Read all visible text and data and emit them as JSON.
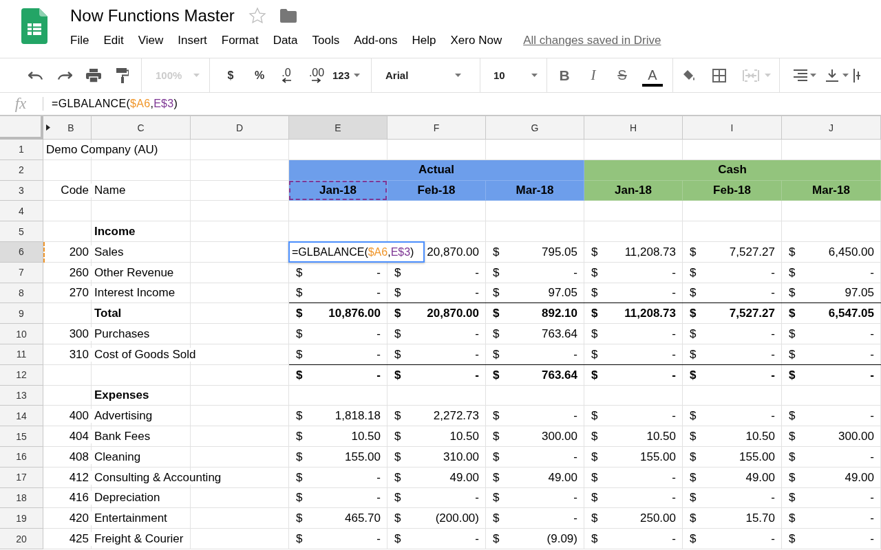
{
  "app": {
    "title": "Now Functions Master",
    "starred": false,
    "save_status": "All changes saved in Drive"
  },
  "menu": [
    "File",
    "Edit",
    "View",
    "Insert",
    "Format",
    "Data",
    "Tools",
    "Add-ons",
    "Help",
    "Xero Now"
  ],
  "toolbar": {
    "zoom": {
      "label": "100%",
      "disabled": true
    },
    "currency": "$",
    "percent": "%",
    "decrease_decimals": ".0",
    "increase_decimals": ".00",
    "number_format": "123",
    "font": "Arial",
    "font_size": "10",
    "bold": "B",
    "italic": "I",
    "strikethrough": "S",
    "text_color": "A"
  },
  "formula_bar": {
    "label": "fx",
    "formula": [
      {
        "text": "=GLBALANCE("
      },
      {
        "text": "$A6",
        "color": "#f0962a"
      },
      {
        "text": ","
      },
      {
        "text": "E$3",
        "color": "#7e3794"
      },
      {
        "text": ")"
      }
    ]
  },
  "columns": [
    {
      "label": "B",
      "selected": false
    },
    {
      "label": "C",
      "selected": false
    },
    {
      "label": "D",
      "selected": false
    },
    {
      "label": "E",
      "selected": true
    },
    {
      "label": "F",
      "selected": false
    },
    {
      "label": "G",
      "selected": false
    },
    {
      "label": "H",
      "selected": false
    },
    {
      "label": "I",
      "selected": false
    },
    {
      "label": "J",
      "selected": false
    }
  ],
  "rows": [
    {
      "number": "1",
      "selected": false,
      "label": "Demo Company (AU)"
    },
    {
      "number": "2",
      "selected": false,
      "bands": [
        {
          "label": "Actual",
          "color": "#6d9eeb"
        },
        {
          "label": "Cash",
          "color": "#93c47d"
        }
      ]
    },
    {
      "number": "3",
      "selected": false,
      "code": "Code",
      "name": "Name",
      "months": [
        {
          "label": "Jan-18",
          "color": "#6d9eeb",
          "referenced": true
        },
        {
          "label": "Feb-18",
          "color": "#6d9eeb",
          "referenced": false
        },
        {
          "label": "Mar-18",
          "color": "#6d9eeb",
          "referenced": false
        },
        {
          "label": "Jan-18",
          "color": "#93c47d",
          "referenced": false
        },
        {
          "label": "Feb-18",
          "color": "#93c47d",
          "referenced": false
        },
        {
          "label": "Mar-18",
          "color": "#93c47d",
          "referenced": false
        }
      ]
    },
    {
      "number": "4",
      "selected": false
    },
    {
      "number": "5",
      "selected": false,
      "name": "Income",
      "bold": true
    },
    {
      "number": "6",
      "selected": true,
      "referenced": true,
      "code": "200",
      "name": "Sales",
      "editor": [
        {
          "text": "=GLBALANCE("
        },
        {
          "text": "$A6",
          "color": "#f0962a"
        },
        {
          "text": ","
        },
        {
          "text": "E$3",
          "color": "#7e3794"
        },
        {
          "text": ")"
        }
      ],
      "values": [
        {
          "amount": "20,870.00"
        },
        {
          "sign": "$",
          "amount": "795.05"
        },
        {
          "sign": "$",
          "amount": "11,208.73"
        },
        {
          "sign": "$",
          "amount": "7,527.27"
        },
        {
          "sign": "$",
          "amount": "6,450.00"
        }
      ]
    },
    {
      "number": "7",
      "selected": false,
      "code": "260",
      "name": "Other Revenue",
      "values": [
        {
          "sign": "$",
          "amount": "-"
        },
        {
          "sign": "$",
          "amount": "-"
        },
        {
          "sign": "$",
          "amount": "-"
        },
        {
          "sign": "$",
          "amount": "-"
        },
        {
          "sign": "$",
          "amount": "-"
        },
        {
          "sign": "$",
          "amount": "-"
        }
      ]
    },
    {
      "number": "8",
      "selected": false,
      "code": "270",
      "name": "Interest Income",
      "values": [
        {
          "sign": "$",
          "amount": "-"
        },
        {
          "sign": "$",
          "amount": "-"
        },
        {
          "sign": "$",
          "amount": "97.05"
        },
        {
          "sign": "$",
          "amount": "-"
        },
        {
          "sign": "$",
          "amount": "-"
        },
        {
          "sign": "$",
          "amount": "97.05"
        }
      ]
    },
    {
      "number": "9",
      "selected": false,
      "name": "Total",
      "bold": true,
      "total": true,
      "values": [
        {
          "sign": "$",
          "amount": "10,876.00"
        },
        {
          "sign": "$",
          "amount": "20,870.00"
        },
        {
          "sign": "$",
          "amount": "892.10"
        },
        {
          "sign": "$",
          "amount": "11,208.73"
        },
        {
          "sign": "$",
          "amount": "7,527.27"
        },
        {
          "sign": "$",
          "amount": "6,547.05"
        }
      ]
    },
    {
      "number": "10",
      "selected": false,
      "code": "300",
      "name": "Purchases",
      "values": [
        {
          "sign": "$",
          "amount": "-"
        },
        {
          "sign": "$",
          "amount": "-"
        },
        {
          "sign": "$",
          "amount": "763.64"
        },
        {
          "sign": "$",
          "amount": "-"
        },
        {
          "sign": "$",
          "amount": "-"
        },
        {
          "sign": "$",
          "amount": "-"
        }
      ]
    },
    {
      "number": "11",
      "selected": false,
      "code": "310",
      "name": "Cost of Goods Sold",
      "values": [
        {
          "sign": "$",
          "amount": "-"
        },
        {
          "sign": "$",
          "amount": "-"
        },
        {
          "sign": "$",
          "amount": "-"
        },
        {
          "sign": "$",
          "amount": "-"
        },
        {
          "sign": "$",
          "amount": "-"
        },
        {
          "sign": "$",
          "amount": "-"
        }
      ]
    },
    {
      "number": "12",
      "selected": false,
      "bold": true,
      "total": true,
      "values": [
        {
          "sign": "$",
          "amount": "-"
        },
        {
          "sign": "$",
          "amount": "-"
        },
        {
          "sign": "$",
          "amount": "763.64"
        },
        {
          "sign": "$",
          "amount": "-"
        },
        {
          "sign": "$",
          "amount": "-"
        },
        {
          "sign": "$",
          "amount": "-"
        }
      ]
    },
    {
      "number": "13",
      "selected": false,
      "name": "Expenses",
      "bold": true
    },
    {
      "number": "14",
      "selected": false,
      "code": "400",
      "name": "Advertising",
      "values": [
        {
          "sign": "$",
          "amount": "1,818.18"
        },
        {
          "sign": "$",
          "amount": "2,272.73"
        },
        {
          "sign": "$",
          "amount": "-"
        },
        {
          "sign": "$",
          "amount": "-"
        },
        {
          "sign": "$",
          "amount": "-"
        },
        {
          "sign": "$",
          "amount": "-"
        }
      ]
    },
    {
      "number": "15",
      "selected": false,
      "code": "404",
      "name": "Bank Fees",
      "values": [
        {
          "sign": "$",
          "amount": "10.50"
        },
        {
          "sign": "$",
          "amount": "10.50"
        },
        {
          "sign": "$",
          "amount": "300.00"
        },
        {
          "sign": "$",
          "amount": "10.50"
        },
        {
          "sign": "$",
          "amount": "10.50"
        },
        {
          "sign": "$",
          "amount": "300.00"
        }
      ]
    },
    {
      "number": "16",
      "selected": false,
      "code": "408",
      "name": "Cleaning",
      "values": [
        {
          "sign": "$",
          "amount": "155.00"
        },
        {
          "sign": "$",
          "amount": "310.00"
        },
        {
          "sign": "$",
          "amount": "-"
        },
        {
          "sign": "$",
          "amount": "155.00"
        },
        {
          "sign": "$",
          "amount": "155.00"
        },
        {
          "sign": "$",
          "amount": "-"
        }
      ]
    },
    {
      "number": "17",
      "selected": false,
      "code": "412",
      "name": "Consulting & Accounting",
      "values": [
        {
          "sign": "$",
          "amount": "-"
        },
        {
          "sign": "$",
          "amount": "49.00"
        },
        {
          "sign": "$",
          "amount": "49.00"
        },
        {
          "sign": "$",
          "amount": "-"
        },
        {
          "sign": "$",
          "amount": "49.00"
        },
        {
          "sign": "$",
          "amount": "49.00"
        }
      ]
    },
    {
      "number": "18",
      "selected": false,
      "code": "416",
      "name": "Depreciation",
      "values": [
        {
          "sign": "$",
          "amount": "-"
        },
        {
          "sign": "$",
          "amount": "-"
        },
        {
          "sign": "$",
          "amount": "-"
        },
        {
          "sign": "$",
          "amount": "-"
        },
        {
          "sign": "$",
          "amount": "-"
        },
        {
          "sign": "$",
          "amount": "-"
        }
      ]
    },
    {
      "number": "19",
      "selected": false,
      "code": "420",
      "name": "Entertainment",
      "values": [
        {
          "sign": "$",
          "amount": "465.70"
        },
        {
          "sign": "$",
          "amount": "(200.00)"
        },
        {
          "sign": "$",
          "amount": "-"
        },
        {
          "sign": "$",
          "amount": "250.00"
        },
        {
          "sign": "$",
          "amount": "15.70"
        },
        {
          "sign": "$",
          "amount": "-"
        }
      ]
    },
    {
      "number": "20",
      "selected": false,
      "code": "425",
      "name": "Freight & Courier",
      "values": [
        {
          "sign": "$",
          "amount": "-"
        },
        {
          "sign": "$",
          "amount": "-"
        },
        {
          "sign": "$",
          "amount": "(9.09)"
        },
        {
          "sign": "$",
          "amount": "-"
        },
        {
          "sign": "$",
          "amount": "-"
        },
        {
          "sign": "$",
          "amount": "-"
        }
      ]
    }
  ]
}
